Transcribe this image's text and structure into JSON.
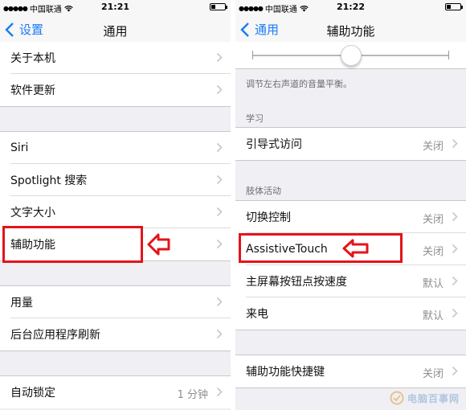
{
  "left": {
    "status": {
      "carrier": "中国联通",
      "time": "21:21"
    },
    "nav": {
      "back_label": "设置",
      "title": "通用"
    },
    "rows": [
      {
        "label": "关于本机"
      },
      {
        "label": "软件更新"
      },
      {
        "label": "Siri"
      },
      {
        "label": "Spotlight 搜索"
      },
      {
        "label": "文字大小"
      },
      {
        "label": "辅助功能"
      },
      {
        "label": "用量"
      },
      {
        "label": "后台应用程序刷新"
      },
      {
        "label": "自动锁定",
        "value": "1 分钟"
      }
    ]
  },
  "right": {
    "status": {
      "carrier": "中国联通",
      "time": "21:22"
    },
    "nav": {
      "back_label": "通用",
      "title": "辅助功能"
    },
    "balance_note": "调节左右声道的音量平衡。",
    "slider": {
      "value": 0.5
    },
    "sections": {
      "learning": "学习",
      "physical": "肢体活动"
    },
    "rows": [
      {
        "label": "引导式访问",
        "value": "关闭"
      },
      {
        "label": "切换控制",
        "value": "关闭"
      },
      {
        "label": "AssistiveTouch",
        "value": "关闭"
      },
      {
        "label": "主屏幕按钮点按速度",
        "value": "默认"
      },
      {
        "label": "来电",
        "value": "默认"
      },
      {
        "label": "辅助功能快捷键",
        "value": "关闭"
      }
    ]
  },
  "watermark": {
    "text": "电脑百事网"
  },
  "colors": {
    "accent": "#1a7cf5",
    "highlight": "#e2141b",
    "separator": "#dcdce0",
    "background": "#efeff4"
  }
}
